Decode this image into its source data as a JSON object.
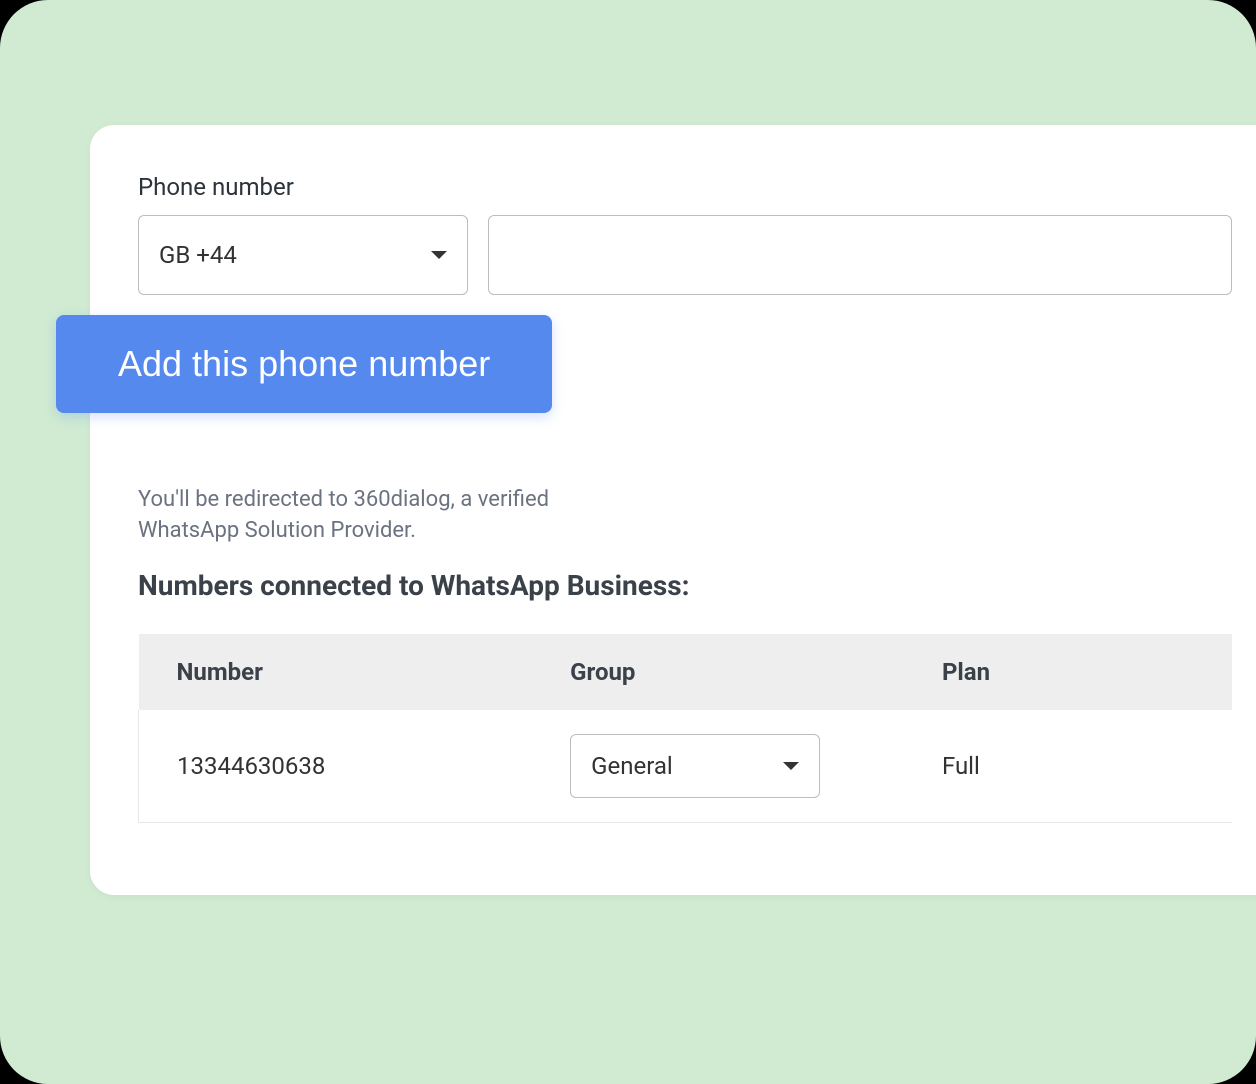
{
  "phone_section": {
    "label": "Phone number",
    "country_selected": "GB +44",
    "number_value": ""
  },
  "add_button_label": "Add this phone number",
  "redirect_info": "You'll be redirected to 360dialog, a verified WhatsApp Solution Provider.",
  "numbers_section": {
    "heading": "Numbers connected to WhatsApp Business:",
    "columns": {
      "number": "Number",
      "group": "Group",
      "plan": "Plan"
    },
    "rows": [
      {
        "number": "13344630638",
        "group_selected": "General",
        "plan": "Full"
      }
    ]
  }
}
